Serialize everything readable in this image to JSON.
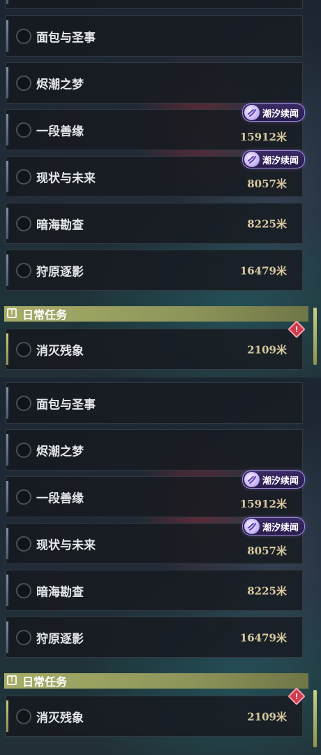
{
  "tags": {
    "tidal_sequel": "潮汐续闻"
  },
  "quests": [
    {
      "title": "面包与圣事"
    },
    {
      "title": "烬潮之梦"
    },
    {
      "title": "一段善缘",
      "distance": "15912米"
    },
    {
      "title": "现状与未来",
      "distance": "8057米"
    },
    {
      "title": "暗海勘查",
      "distance": "8225米"
    },
    {
      "title": "狩原逐影",
      "distance": "16479米"
    }
  ],
  "daily": {
    "header": "日常任务",
    "quests": [
      {
        "title": "消灭残象",
        "distance": "2109米"
      }
    ]
  },
  "colors": {
    "daily_accent": "#a7ad68",
    "tag_purple": "#3a2a66",
    "alert_red": "#d23a4e",
    "distance_gold": "#d8c9a0"
  },
  "icons": [
    "checkbox-circle-icon",
    "tidal-swirl-icon",
    "alert-diamond-icon",
    "daily-quest-icon"
  ]
}
